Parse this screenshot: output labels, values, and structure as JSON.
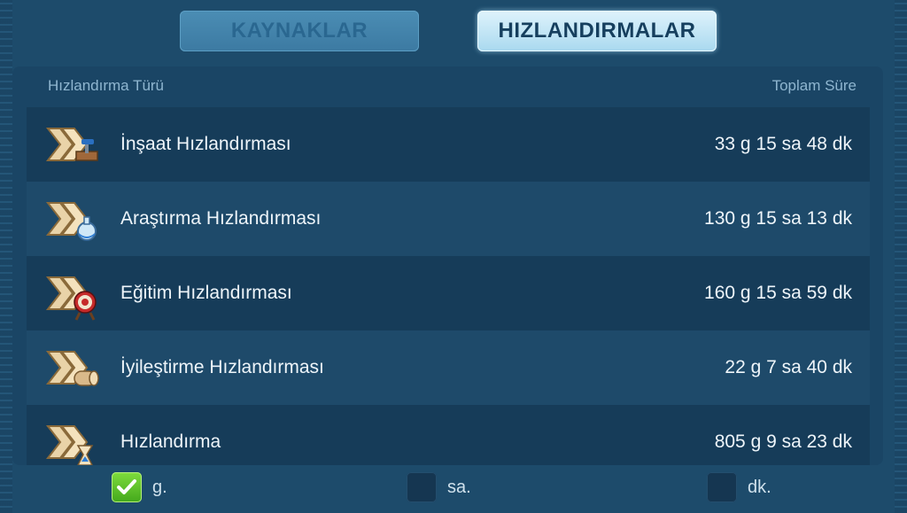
{
  "tabs": {
    "resources_label": "KAYNAKLAR",
    "speedups_label": "HIZLANDIRMALAR",
    "active": "speedups"
  },
  "table": {
    "col_type": "Hızlandırma Türü",
    "col_total": "Toplam Süre",
    "rows": [
      {
        "label": "İnşaat Hızlandırması",
        "value": "33 g 15 sa 48 dk",
        "icon": "construction-speedup-icon"
      },
      {
        "label": "Araştırma Hızlandırması",
        "value": "130 g 15 sa 13 dk",
        "icon": "research-speedup-icon"
      },
      {
        "label": "Eğitim Hızlandırması",
        "value": "160 g 15 sa 59 dk",
        "icon": "training-speedup-icon"
      },
      {
        "label": "İyileştirme Hızlandırması",
        "value": "22 g 7 sa 40 dk",
        "icon": "healing-speedup-icon"
      },
      {
        "label": "Hızlandırma",
        "value": "805 g 9 sa 23 dk",
        "icon": "universal-speedup-icon"
      }
    ]
  },
  "filters": {
    "days": {
      "label": "g.",
      "checked": true
    },
    "hours": {
      "label": "sa.",
      "checked": false
    },
    "minutes": {
      "label": "dk.",
      "checked": false
    }
  },
  "colors": {
    "background": "#1d4b6b",
    "active_tab": "#a9d9ef",
    "checkbox_on": "#43a81c"
  }
}
